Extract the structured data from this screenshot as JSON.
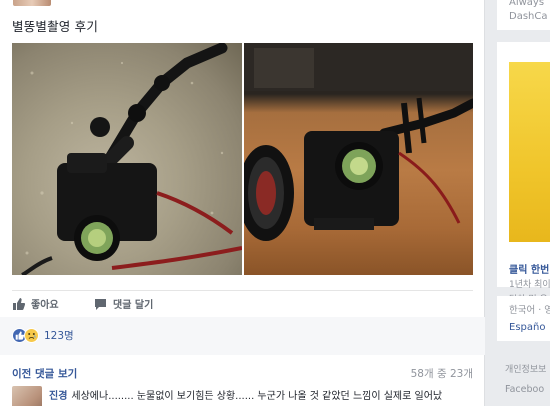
{
  "post": {
    "text": "별똥별촬영 후기"
  },
  "actions": {
    "like_label": "좋아요",
    "comment_label": "댓글 달기"
  },
  "reactions": {
    "count": "123명"
  },
  "comments": {
    "previous_label": "이전 댓글 보기",
    "count_label": "58개 중 23개",
    "first": {
      "author": "진경",
      "text": "세상에나........ 눈물없이 보기힘든 상황...... 누군가 나올 것 같았던 느낌이 실제로 일어났"
    }
  },
  "sidebar": {
    "top_line1": "Always",
    "top_line2": "DashCa",
    "ad_title": "클릭 한번",
    "ad_line2": "1년차 최이",
    "ad_line3": "탑차 및 유",
    "lang_current": "한국어 · 영",
    "lang_alt": "Españo",
    "footer1": "개인정보보",
    "footer2": "Faceboo"
  },
  "colors": {
    "link": "#365899",
    "brand": "#4267b2",
    "background": "#e9ebee"
  }
}
